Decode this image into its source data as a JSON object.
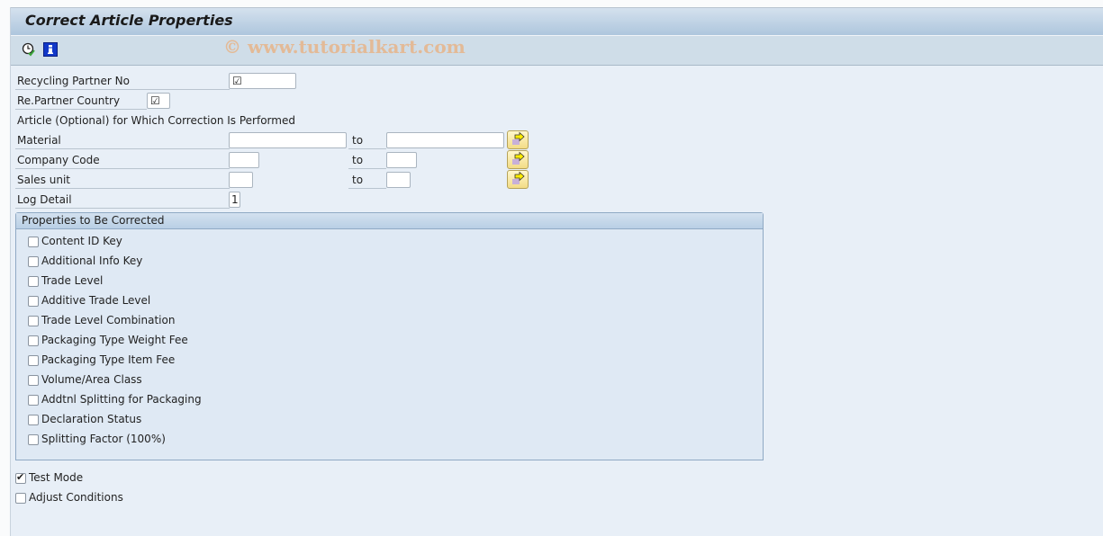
{
  "window": {
    "title": "Correct Article Properties",
    "watermark": "© www.tutorialkart.com"
  },
  "toolbar": {
    "items": [
      {
        "icon": "execute-clock-icon",
        "label": "Execute"
      },
      {
        "icon": "info-icon",
        "label": "Information"
      }
    ]
  },
  "selection": {
    "recycling_partner_no": {
      "label": "Recycling Partner No",
      "value": "☑"
    },
    "re_partner_country": {
      "label": "Re.Partner Country",
      "value": "☑"
    },
    "article_section_label": "Article (Optional) for Which Correction Is Performed",
    "material": {
      "label": "Material",
      "from": "",
      "to_label": "to",
      "to": ""
    },
    "company_code": {
      "label": "Company Code",
      "from": "",
      "to_label": "to",
      "to": ""
    },
    "sales_unit": {
      "label": "Sales unit",
      "from": "",
      "to_label": "to",
      "to": ""
    },
    "log_detail": {
      "label": "Log Detail",
      "value": "1"
    }
  },
  "properties_group": {
    "title": "Properties to Be Corrected",
    "items": [
      {
        "label": "Content ID Key",
        "checked": false
      },
      {
        "label": "Additional Info Key",
        "checked": false
      },
      {
        "label": "Trade Level",
        "checked": false
      },
      {
        "label": "Additive Trade Level",
        "checked": false
      },
      {
        "label": "Trade Level Combination",
        "checked": false
      },
      {
        "label": "Packaging Type Weight Fee",
        "checked": false
      },
      {
        "label": "Packaging Type Item Fee",
        "checked": false
      },
      {
        "label": "Volume/Area Class",
        "checked": false
      },
      {
        "label": "Addtnl Splitting for Packaging",
        "checked": false
      },
      {
        "label": "Declaration Status",
        "checked": false
      },
      {
        "label": "Splitting Factor (100%)",
        "checked": false
      }
    ]
  },
  "options": {
    "test_mode": {
      "label": "Test Mode",
      "checked": true
    },
    "adjust_conditions": {
      "label": "Adjust Conditions",
      "checked": false
    }
  }
}
